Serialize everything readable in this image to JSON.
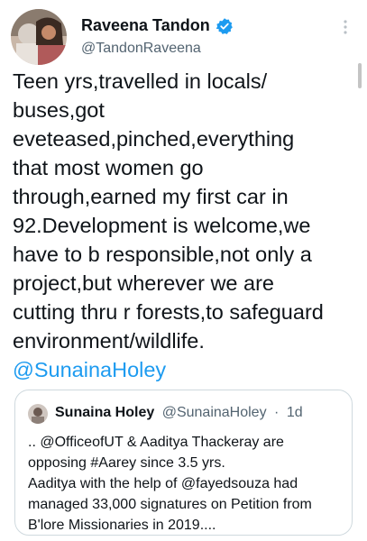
{
  "author": {
    "display_name": "Raveena Tandon",
    "handle": "@TandonRaveena",
    "verified": true
  },
  "icons": {
    "verified": "verified-badge-icon",
    "more": "more-vertical-icon"
  },
  "colors": {
    "link": "#1d9bf0",
    "verified": "#1d9bf0",
    "secondary_text": "#536471",
    "border": "#cfd9de"
  },
  "tweet": {
    "lines": [
      "Teen yrs,travelled in locals/",
      "buses,got",
      "eveteased,pinched,everything",
      "that most women go",
      "through,earned my first car in",
      "92.Development is welcome,we",
      "have to b responsible,not only a",
      "project,but wherever we are",
      "cutting thru r forests,to safeguard",
      "environment/wildlife."
    ],
    "mention": "@SunainaHoley"
  },
  "quoted_tweet": {
    "display_name": "Sunaina Holey",
    "handle": "@SunainaHoley",
    "separator": "·",
    "time": "1d",
    "lines": [
      ".. @OfficeofUT & Aaditya Thackeray are",
      "opposing #Aarey since 3.5 yrs.",
      "Aaditya with the help of @fayedsouza had",
      "managed 33,000 signatures on Petition from",
      "B'lore Missionaries in 2019...."
    ]
  }
}
